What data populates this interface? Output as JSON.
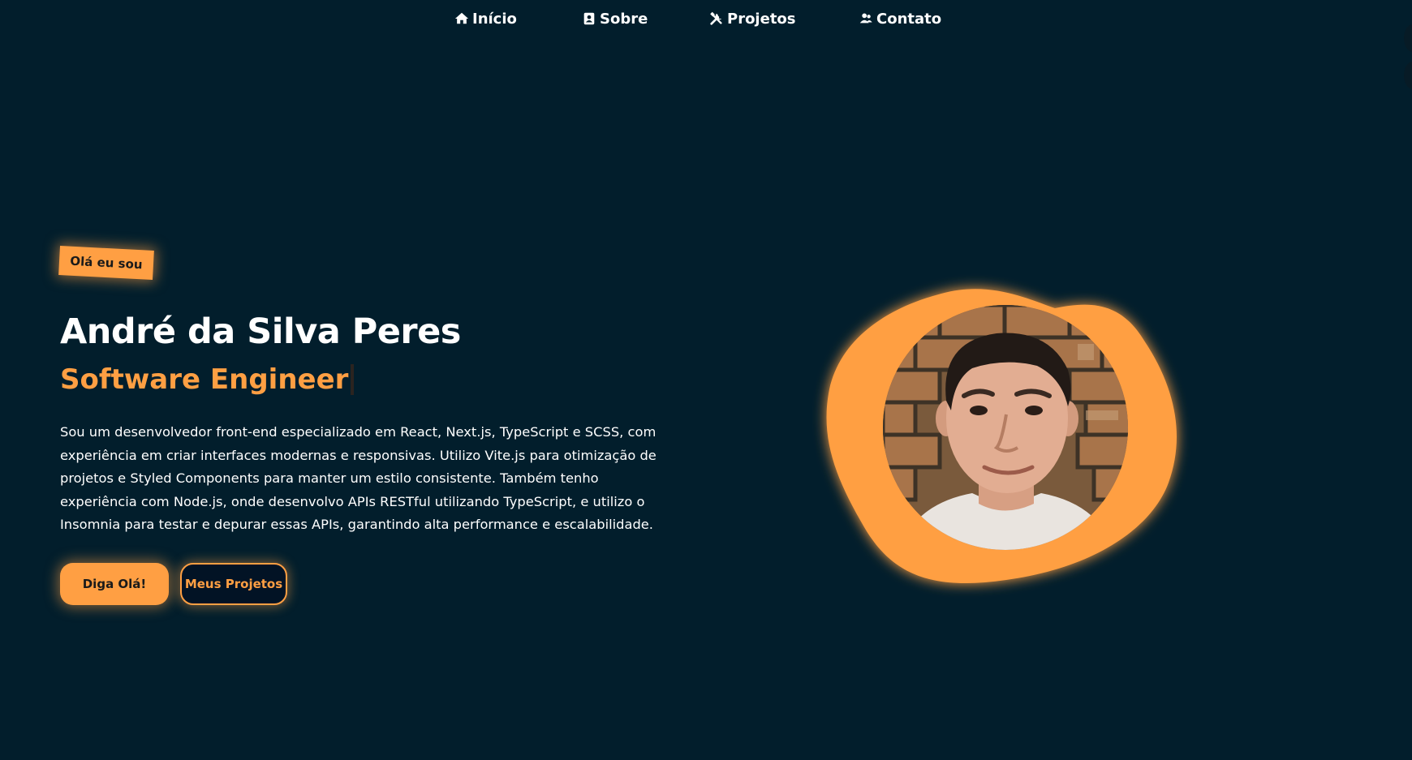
{
  "nav": {
    "items": [
      {
        "label": "Início",
        "icon": "home-icon"
      },
      {
        "label": "Sobre",
        "icon": "id-card-icon"
      },
      {
        "label": "Projetos",
        "icon": "tools-icon"
      },
      {
        "label": "Contato",
        "icon": "users-icon"
      }
    ]
  },
  "hero": {
    "badge": "Olá eu sou",
    "name": "André da Silva Peres",
    "role": "Software Engineer",
    "bio": "Sou um desenvolvedor front-end especializado em React, Next.js, TypeScript e SCSS, com experiência em criar interfaces modernas e responsivas. Utilizo Vite.js para otimização de projetos e Styled Components para manter um estilo consistente. Também tenho experiência com Node.js, onde desenvolvo APIs RESTful utilizando TypeScript, e utilizo o Insomnia para testar e depurar essas APIs, garantindo alta performance e escalabilidade.",
    "primary_button": "Diga Olá!",
    "secondary_button": "Meus Projetos"
  },
  "colors": {
    "background": "#021e2c",
    "accent": "#ff9f43",
    "text": "#ffffff"
  }
}
